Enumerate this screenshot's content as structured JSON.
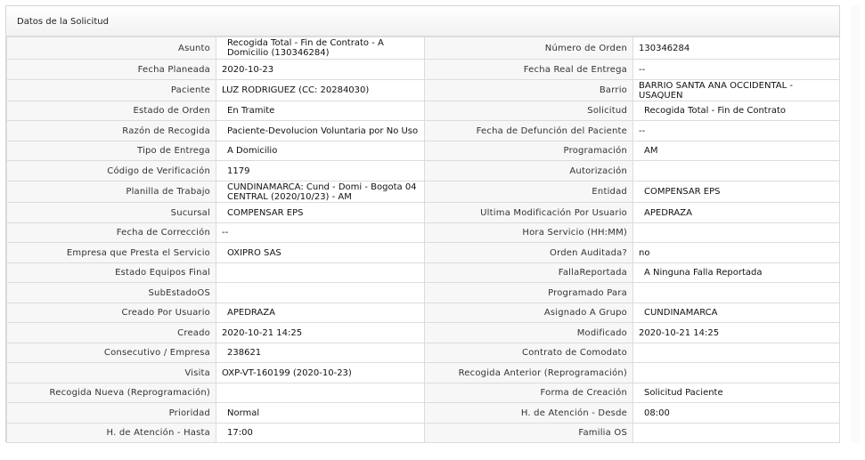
{
  "panel": {
    "title": "Datos de la Solicitud"
  },
  "rows": [
    {
      "h": 25,
      "l1": "Asunto",
      "v1": "Recogida Total - Fin de Contrato - A Domicilio (130346284)",
      "l2": "Número de Orden",
      "v2": "130346284"
    },
    {
      "h": 23,
      "l1": "Fecha Planeada",
      "v1": "2020-10-23",
      "l2": "Fecha Real de Entrega",
      "v2": "--"
    },
    {
      "h": 24,
      "l1": "Paciente",
      "v1": "LUZ RODRIGUEZ (CC: 20284030)",
      "l2": "Barrio",
      "v2": "BARRIO SANTA ANA OCCIDENTAL - USAQUEN"
    },
    {
      "h": 22,
      "l1": "Estado de Orden",
      "v1": "En Tramite",
      "l2": "Solicitud",
      "v2": "Recogida Total - Fin de Contrato"
    },
    {
      "h": 23,
      "l1": "Razón de Recogida",
      "v1": "Paciente-Devolucion Voluntaria por No Uso",
      "l2": "Fecha de Defunción del Paciente",
      "v2": "--"
    },
    {
      "h": 22,
      "l1": "Tipo de Entrega",
      "v1": "A Domicilio",
      "l2": "Programación",
      "v2": "AM"
    },
    {
      "h": 23,
      "l1": "Código de Verificación",
      "v1": "1179",
      "l2": "Autorización",
      "v2": ""
    },
    {
      "h": 24,
      "l1": "Planilla de Trabajo",
      "v1": "CUNDINAMARCA: Cund - Domi - Bogota 04 CENTRAL (2020/10/23) - AM",
      "l2": "Entidad",
      "v2": "COMPENSAR EPS"
    },
    {
      "h": 23,
      "l1": "Sucursal",
      "v1": "COMPENSAR EPS",
      "l2": "Ultima Modificación Por Usuario",
      "v2": "APEDRAZA"
    },
    {
      "h": 22,
      "l1": "Fecha de Corrección",
      "v1": "--",
      "l2": "Hora Servicio (HH:MM)",
      "v2": ""
    },
    {
      "h": 23,
      "l1": "Empresa que Presta el Servicio",
      "v1": "OXIPRO SAS",
      "l2": "Orden Auditada?",
      "v2": "no"
    },
    {
      "h": 22,
      "l1": "Estado Equipos Final",
      "v1": "",
      "l2": "FallaReportada",
      "v2": "A Ninguna Falla Reportada"
    },
    {
      "h": 23,
      "l1": "SubEstadoOS",
      "v1": "",
      "l2": "Programado Para",
      "v2": ""
    },
    {
      "h": 22,
      "l1": "Creado Por Usuario",
      "v1": "APEDRAZA",
      "l2": "Asignado A Grupo",
      "v2": "CUNDINAMARCA"
    },
    {
      "h": 23,
      "l1": "Creado",
      "v1": "2020-10-21 14:25",
      "l2": "Modificado",
      "v2": "2020-10-21 14:25"
    },
    {
      "h": 22,
      "l1": "Consecutivo / Empresa",
      "v1": "238621",
      "l2": "Contrato de Comodato",
      "v2": ""
    },
    {
      "h": 23,
      "l1": "Visita",
      "v1": "OXP-VT-160199 (2020-10-23)",
      "l2": "Recogida Anterior (Reprogramación)",
      "v2": ""
    },
    {
      "h": 22,
      "l1": "Recogida Nueva (Reprogramación)",
      "v1": "",
      "l2": "Forma de Creación",
      "v2": "Solicitud Paciente"
    },
    {
      "h": 23,
      "l1": "Prioridad",
      "v1": "Normal",
      "l2": "H. de Atención - Desde",
      "v2": "08:00"
    },
    {
      "h": 22,
      "l1": "H. de Atención - Hasta",
      "v1": "17:00",
      "l2": "Familia OS",
      "v2": ""
    }
  ]
}
